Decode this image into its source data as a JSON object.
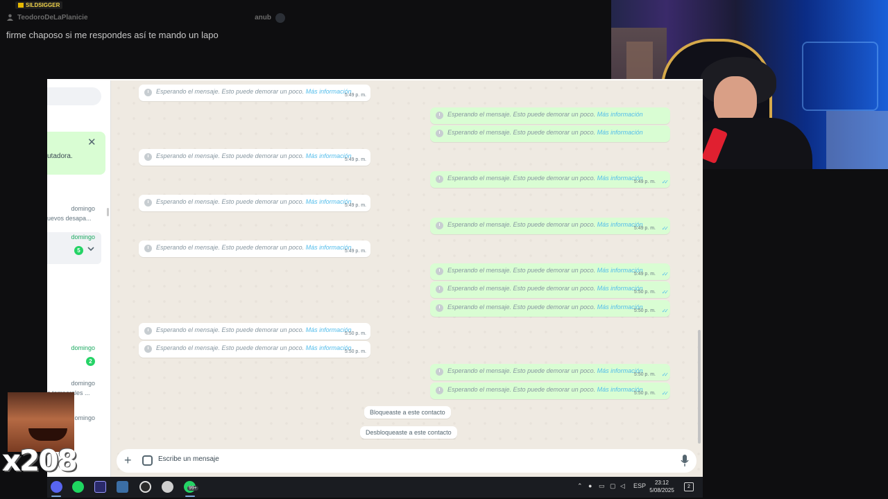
{
  "stream_chat": {
    "badge": "SILDSIGGER",
    "username": "TeodoroDeLaPlanicie",
    "other_user": "anub",
    "message": "firme chaposo si me respondes así te mando un lapo"
  },
  "sidebar": {
    "notice_text": "utadora.",
    "items": [
      {
        "day": "domingo",
        "snippet": "uevos desapa..."
      },
      {
        "day": "domingo",
        "count": "5"
      },
      {
        "day": "domingo",
        "count": "2"
      },
      {
        "day": "domingo",
        "snippet": "s temporales ..."
      },
      {
        "day": "domingo"
      }
    ]
  },
  "chat": {
    "waiting_text": "Esperando el mensaje. Esto puede demorar un poco.",
    "more_info": "Más información",
    "ticks": "✓✓",
    "messages": [
      {
        "dir": "in",
        "time": "5:49 p. m."
      },
      {
        "dir": "out",
        "time": ""
      },
      {
        "dir": "out",
        "time": ""
      },
      {
        "dir": "in",
        "time": "5:49 p. m."
      },
      {
        "dir": "out",
        "time": "5:49 p. m."
      },
      {
        "dir": "in",
        "time": "5:49 p. m."
      },
      {
        "dir": "out",
        "time": "5:49 p. m."
      },
      {
        "dir": "in",
        "time": "5:49 p. m."
      },
      {
        "dir": "out",
        "time": "5:49 p. m."
      },
      {
        "dir": "out",
        "time": "5:50 p. m."
      },
      {
        "dir": "out",
        "time": "5:50 p. m."
      },
      {
        "dir": "in",
        "time": "5:50 p. m."
      },
      {
        "dir": "in",
        "time": "5:50 p. m."
      },
      {
        "dir": "out",
        "time": "5:50 p. m."
      },
      {
        "dir": "out",
        "time": "5:50 p. m."
      }
    ],
    "system": [
      "Bloqueaste a este contacto",
      "Desbloqueaste a este contacto"
    ],
    "input_placeholder": "Escribe un mensaje"
  },
  "emote": {
    "count": "x208"
  },
  "taskbar": {
    "apps": [
      "discord-icon",
      "spotify-icon",
      "premiere-icon",
      "calculator-icon",
      "obs-icon",
      "chatgpt-icon",
      "whatsapp-icon"
    ],
    "whatsapp_badge": "99+",
    "language": "ESP",
    "time": "23:12",
    "date": "5/08/2025",
    "notifications": "2"
  },
  "colors": {
    "wa_outgoing": "#d9fdd3",
    "wa_incoming": "#ffffff",
    "wa_background": "#efeae2",
    "wa_green": "#25d366",
    "wa_link": "#53bdeb",
    "taskbar_bg": "#1a1c21"
  }
}
